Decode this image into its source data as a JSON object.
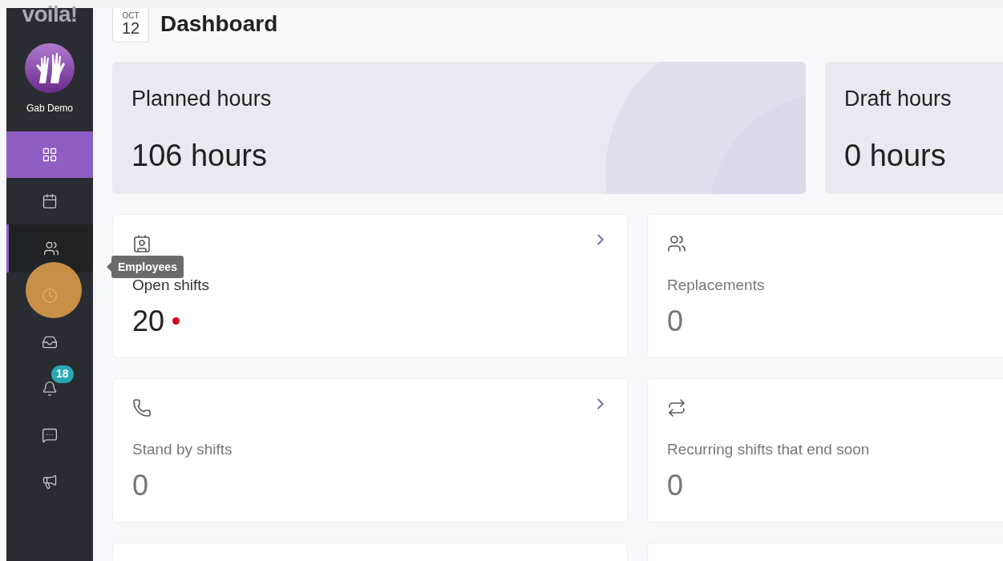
{
  "sidebar": {
    "logo": "voila!",
    "account": "Gab Demo",
    "items": [
      {
        "selected": true,
        "hovered": false
      },
      {
        "selected": false,
        "hovered": false
      },
      {
        "selected": false,
        "hovered": true
      },
      {
        "selected": false,
        "hovered": false
      },
      {
        "selected": false,
        "hovered": false
      },
      {
        "selected": false,
        "hovered": false,
        "badge": "18"
      },
      {
        "selected": false,
        "hovered": false
      },
      {
        "selected": false,
        "hovered": false
      }
    ],
    "tooltip": "Employees"
  },
  "header": {
    "date_month": "OCT",
    "date_day": "12",
    "title": "Dashboard"
  },
  "summary": [
    {
      "label": "Planned hours",
      "value": "106 hours"
    },
    {
      "label": "Draft hours",
      "value": "0 hours"
    }
  ],
  "tiles": [
    {
      "label": "Open shifts",
      "value": "20",
      "alert": true,
      "link": true
    },
    {
      "label": "Replacements",
      "value": "0",
      "alert": false
    },
    {
      "label": "Stand by shifts",
      "value": "0",
      "alert": false,
      "link": true
    },
    {
      "label": "Recurring shifts that end soon",
      "value": "0",
      "alert": false
    }
  ]
}
